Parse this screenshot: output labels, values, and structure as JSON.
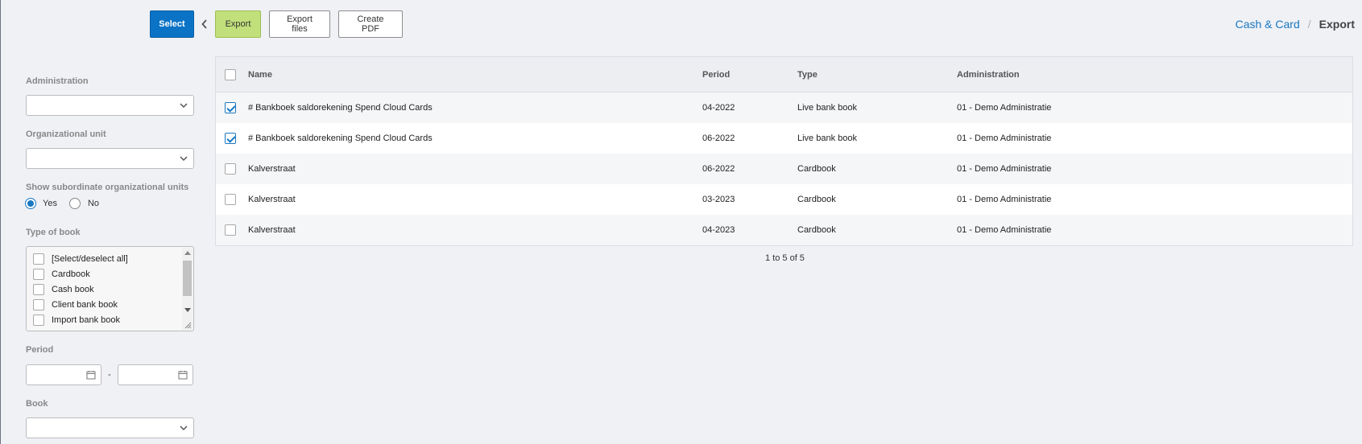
{
  "toolbar": {
    "select_label": "Select",
    "export_label": "Export",
    "export_files_label": "Export files",
    "create_pdf_label": "Create PDF"
  },
  "breadcrumb": {
    "parent": "Cash & Card",
    "separator": "/",
    "current": "Export"
  },
  "filters": {
    "administration": {
      "label": "Administration",
      "value": ""
    },
    "org_unit": {
      "label": "Organizational unit",
      "value": ""
    },
    "subordinate": {
      "label": "Show subordinate organizational units",
      "yes_label": "Yes",
      "no_label": "No",
      "selected": "Yes"
    },
    "type_of_book": {
      "label": "Type of book",
      "items": [
        {
          "label": "[Select/deselect all]",
          "checked": false
        },
        {
          "label": "Cardbook",
          "checked": false
        },
        {
          "label": "Cash book",
          "checked": false
        },
        {
          "label": "Client bank book",
          "checked": false
        },
        {
          "label": "Import bank book",
          "checked": false
        }
      ]
    },
    "period": {
      "label": "Period",
      "from": "",
      "to": "",
      "separator": "-"
    },
    "book": {
      "label": "Book",
      "value": ""
    }
  },
  "table": {
    "columns": {
      "name": "Name",
      "period": "Period",
      "type": "Type",
      "administration": "Administration"
    },
    "rows": [
      {
        "checked": true,
        "name": "# Bankboek saldorekening Spend Cloud Cards",
        "period": "04-2022",
        "type": "Live bank book",
        "administration": "01 - Demo Administratie"
      },
      {
        "checked": true,
        "name": "# Bankboek saldorekening Spend Cloud Cards",
        "period": "06-2022",
        "type": "Live bank book",
        "administration": "01 - Demo Administratie"
      },
      {
        "checked": false,
        "name": "Kalverstraat",
        "period": "06-2022",
        "type": "Cardbook",
        "administration": "01 - Demo Administratie"
      },
      {
        "checked": false,
        "name": "Kalverstraat",
        "period": "03-2023",
        "type": "Cardbook",
        "administration": "01 - Demo Administratie"
      },
      {
        "checked": false,
        "name": "Kalverstraat",
        "period": "04-2023",
        "type": "Cardbook",
        "administration": "01 - Demo Administratie"
      }
    ],
    "pager_text": "1 to 5 of 5"
  },
  "colors": {
    "primary": "#0a73c6",
    "export_green": "#c1e07b",
    "link": "#1a78c2",
    "background": "#eff1f5"
  }
}
